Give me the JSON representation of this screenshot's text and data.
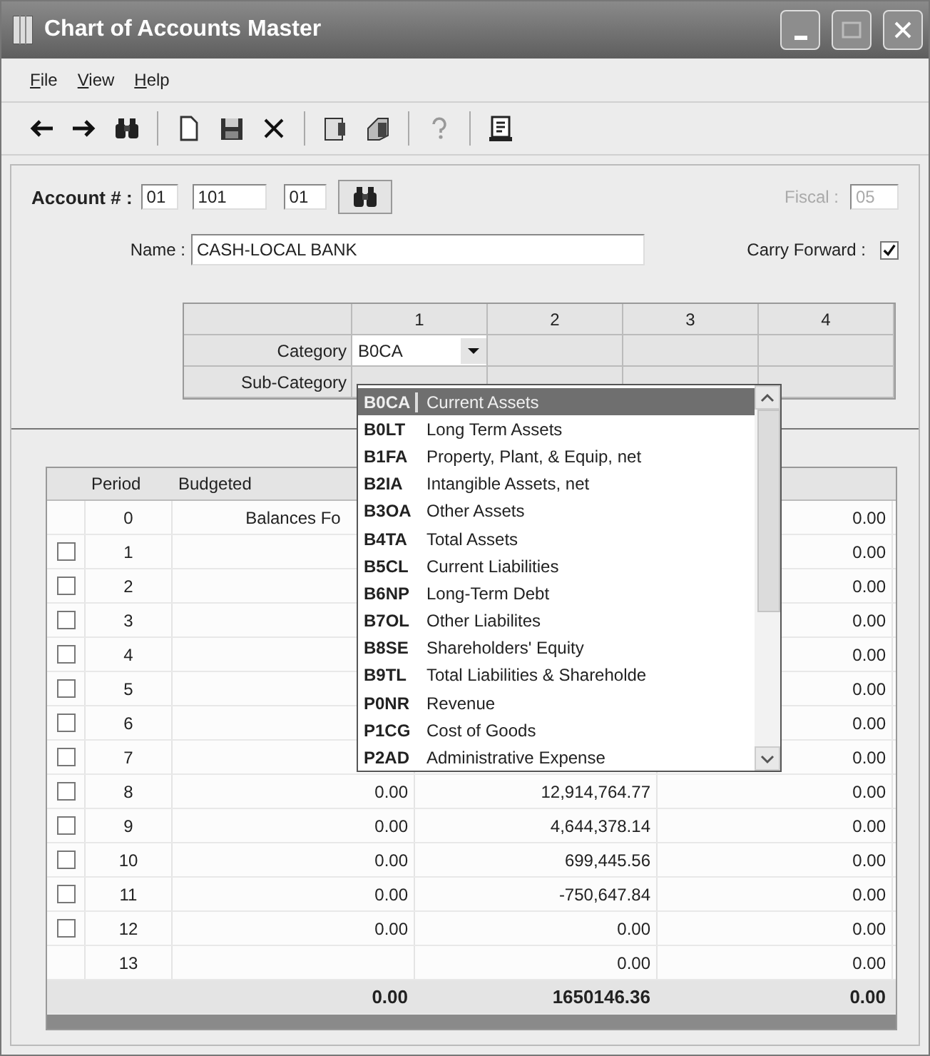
{
  "window": {
    "title": "Chart of Accounts Master"
  },
  "menu": [
    "File",
    "View",
    "Help"
  ],
  "account": {
    "label": "Account # :",
    "segments": [
      "01",
      "101",
      "01"
    ]
  },
  "fiscal": {
    "label": "Fiscal :",
    "value": "05",
    "disabled": true
  },
  "name": {
    "label": "Name :",
    "value": "CASH-LOCAL BANK"
  },
  "carry_forward": {
    "label": "Carry Forward :",
    "checked": true
  },
  "category_grid": {
    "columns": [
      "1",
      "2",
      "3",
      "4"
    ],
    "rows": [
      {
        "label": "Category",
        "value": "B0CA"
      },
      {
        "label": "Sub-Category"
      }
    ]
  },
  "dropdown": {
    "items": [
      {
        "code": "B0CA",
        "name": "Current Assets",
        "selected": true
      },
      {
        "code": "B0LT",
        "name": "Long Term Assets",
        "selected": false
      },
      {
        "code": "B1FA",
        "name": "Property, Plant, & Equip, net",
        "selected": false
      },
      {
        "code": "B2IA",
        "name": "Intangible Assets, net",
        "selected": false
      },
      {
        "code": "B3OA",
        "name": "Other Assets",
        "selected": false
      },
      {
        "code": "B4TA",
        "name": "Total Assets",
        "selected": false
      },
      {
        "code": "B5CL",
        "name": "Current Liabilities",
        "selected": false
      },
      {
        "code": "B6NP",
        "name": "Long-Term Debt",
        "selected": false
      },
      {
        "code": "B7OL",
        "name": "Other Liabilites",
        "selected": false
      },
      {
        "code": "B8SE",
        "name": "Shareholders' Equity",
        "selected": false
      },
      {
        "code": "B9TL",
        "name": "Total Liabilities & Shareholde",
        "selected": false
      },
      {
        "code": "P0NR",
        "name": "Revenue",
        "selected": false
      },
      {
        "code": "P1CG",
        "name": "Cost of Goods",
        "selected": false
      },
      {
        "code": "P2AD",
        "name": "Administrative Expense",
        "selected": false
      }
    ]
  },
  "ledger": {
    "columns": [
      "Period",
      "Budgeted"
    ],
    "rows": [
      {
        "period": "0",
        "budgeted": "Balances Fo",
        "column_4": "0.00"
      },
      {
        "period": "1",
        "checked": false,
        "column_4": "0.00"
      },
      {
        "period": "2",
        "checked": false,
        "column_4": "0.00"
      },
      {
        "period": "3",
        "checked": false,
        "column_4": "0.00"
      },
      {
        "period": "4",
        "checked": false,
        "column_4": "0.00"
      },
      {
        "period": "5",
        "checked": false,
        "column_4": "0.00"
      },
      {
        "period": "6",
        "checked": false,
        "column_4": "0.00"
      },
      {
        "period": "7",
        "checked": false,
        "column_4": "0.00"
      },
      {
        "period": "8",
        "checked": false,
        "budgeted": "0.00",
        "column_3": "12,914,764.77",
        "column_4": "0.00"
      },
      {
        "period": "9",
        "checked": false,
        "budgeted": "0.00",
        "column_3": "4,644,378.14",
        "column_4": "0.00"
      },
      {
        "period": "10",
        "checked": false,
        "budgeted": "0.00",
        "column_3": "699,445.56",
        "column_4": "0.00"
      },
      {
        "period": "11",
        "checked": false,
        "budgeted": "0.00",
        "column_3": "-750,647.84",
        "column_4": "0.00"
      },
      {
        "period": "12",
        "checked": false,
        "budgeted": "0.00",
        "column_3": "0.00",
        "column_4": "0.00"
      },
      {
        "period": "13",
        "column_3": "0.00",
        "column_4": "0.00"
      }
    ],
    "totals": [
      "0.00",
      "1650146.36",
      "0.00"
    ]
  }
}
